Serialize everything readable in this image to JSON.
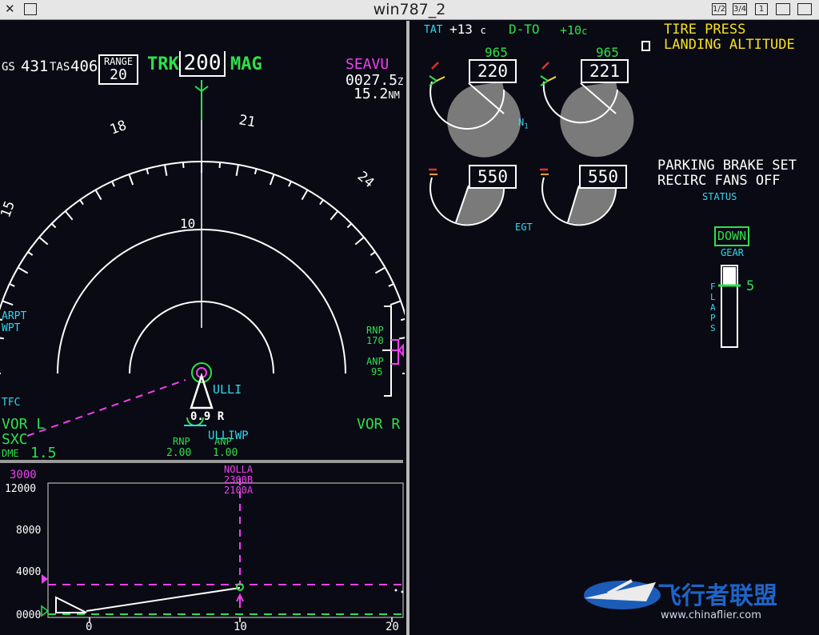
{
  "window": {
    "title": "win787_2",
    "buttons": [
      "1/2",
      "3/4",
      "1"
    ]
  },
  "nd": {
    "gs_label": "GS",
    "gs": "431",
    "tas_label": "TAS",
    "tas": "406",
    "range_label": "RANGE",
    "range": "20",
    "trk": "TRK",
    "heading": "200",
    "mag": "MAG",
    "waypoint": "SEAVU",
    "eta": "0027.5",
    "eta_unit": "Z",
    "dist": "15.2",
    "dist_unit": "NM",
    "compass": [
      "15",
      "18",
      "21",
      "24"
    ],
    "ring_label": "10",
    "arpt": "ARPT",
    "wpt": "WPT",
    "tfc": "TFC",
    "vor_l": "VOR L",
    "vor_r": "VOR R",
    "sxc": "SXC",
    "dme_label": "DME",
    "dme": "1.5",
    "ulli": "ULLI",
    "ulli_wp": "ULLIWP",
    "pos_dist": "0.9",
    "pos_unit": "R",
    "rnp_label": "RNP",
    "rnp": "2.00",
    "anp_label": "ANP",
    "anp": "1.00",
    "rnp_bar_label": "RNP",
    "rnp_bar": "170",
    "anp_bar_label": "ANP",
    "anp_bar": "95"
  },
  "vsd": {
    "alt_sel": "3000",
    "y_ticks": [
      "12000",
      "8000",
      "4000",
      "0000"
    ],
    "x_ticks": [
      "0",
      "10",
      "20"
    ],
    "fix_name": "NOLLA",
    "fix_alt1": "2300B",
    "fix_alt2": "2100A"
  },
  "eicas": {
    "tat_label": "TAT",
    "tat": "+13",
    "tat_unit": "c",
    "dto": "D-TO",
    "dto_temp": "+10",
    "dto_unit": "c",
    "n1_left": "220",
    "n1_right": "221",
    "n1_ref_left": "965",
    "n1_ref_right": "965",
    "n1_label": "N",
    "n1_sub": "1",
    "egt_left": "550",
    "egt_right": "550",
    "egt_label": "EGT",
    "caution1": "TIRE PRESS",
    "caution2": "LANDING ALTITUDE",
    "status1": "PARKING BRAKE SET",
    "status2": "RECIRC FANS OFF",
    "status_label": "STATUS",
    "gear": "DOWN",
    "gear_label": "GEAR",
    "flaps_label": "FLAPS",
    "flaps": "5"
  },
  "watermark": {
    "name": "飞行者联盟",
    "url": "www.chinaflier.com"
  },
  "colors": {
    "green": "#2ee04a",
    "cyan": "#2fd8f0",
    "magenta": "#f040f0",
    "amber": "#f5e020",
    "bg": "#0a0a14"
  }
}
